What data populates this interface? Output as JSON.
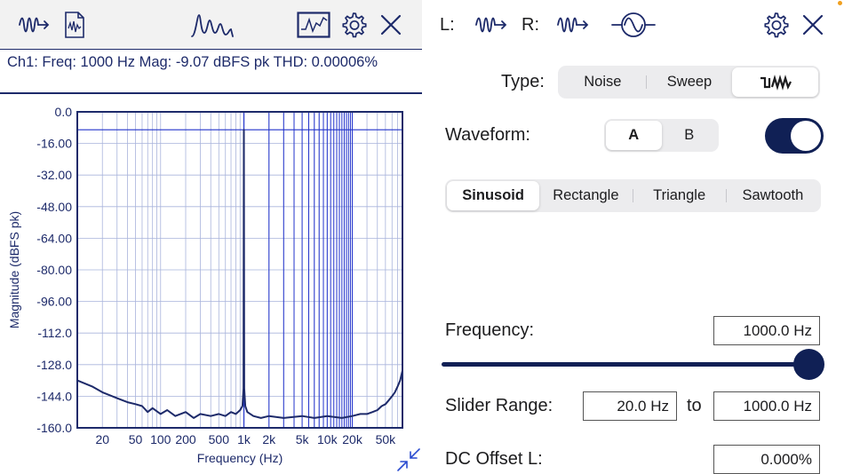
{
  "left_panel": {
    "info_line": "Ch1:  Freq: 1000 Hz   Mag: -9.07 dBFS pk    THD: 0.00006%",
    "toolbar": {
      "icons": [
        "generator-icon",
        "export-file-icon",
        "spectrum-peaks-icon",
        "trace-view-icon",
        "gear-icon",
        "close-icon"
      ]
    }
  },
  "chart_data": {
    "type": "line",
    "title": "",
    "xlabel": "Frequency (Hz)",
    "ylabel": "Magnitude (dBFS pk)",
    "x_scale": "log",
    "xlim": [
      10,
      80000
    ],
    "ylim": [
      -160,
      0
    ],
    "x_ticks": [
      {
        "value": 20,
        "label": "20"
      },
      {
        "value": 50,
        "label": "50"
      },
      {
        "value": 100,
        "label": "100"
      },
      {
        "value": 200,
        "label": "200"
      },
      {
        "value": 500,
        "label": "500"
      },
      {
        "value": 1000,
        "label": "1k"
      },
      {
        "value": 2000,
        "label": "2k"
      },
      {
        "value": 5000,
        "label": "5k"
      },
      {
        "value": 10000,
        "label": "10k"
      },
      {
        "value": 20000,
        "label": "20k"
      },
      {
        "value": 50000,
        "label": "50k"
      }
    ],
    "y_ticks": [
      "0.0",
      "-16.00",
      "-32.00",
      "-48.00",
      "-64.00",
      "-80.00",
      "-96.00",
      "-112.0",
      "-128.0",
      "-144.0",
      "-160.0"
    ],
    "y_tick_values": [
      0,
      -16,
      -32,
      -48,
      -64,
      -80,
      -96,
      -112,
      -128,
      -144,
      -160
    ],
    "grid": true,
    "cursor": {
      "freq": 1000,
      "mag": -9.07
    },
    "harmonic_markers_hz": [
      2000,
      3000,
      4000,
      5000,
      6000,
      7000,
      8000,
      9000,
      10000,
      11000,
      12000,
      13000,
      14000,
      15000,
      16000,
      17000,
      18000,
      19000,
      20000
    ],
    "series": [
      {
        "color": "#1d2a6a",
        "x": [
          10,
          15,
          20,
          30,
          40,
          50,
          60,
          70,
          80,
          100,
          120,
          150,
          200,
          250,
          300,
          400,
          500,
          600,
          700,
          800,
          900,
          960,
          990,
          1000,
          1010,
          1040,
          1100,
          1300,
          1600,
          2000,
          3000,
          5000,
          7000,
          10000,
          15000,
          20000,
          25000,
          30000,
          35000,
          40000,
          45000,
          50000,
          55000,
          60000,
          65000,
          70000,
          75000,
          80000
        ],
        "y": [
          -136,
          -139,
          -142,
          -145,
          -147,
          -148,
          -149,
          -152,
          -150,
          -153,
          -151,
          -154,
          -152,
          -155,
          -153,
          -154,
          -153,
          -154,
          -152,
          -153,
          -151,
          -149,
          -140,
          -9.07,
          -140,
          -149,
          -152,
          -154,
          -155,
          -154,
          -155,
          -154,
          -155,
          -154,
          -155,
          -154,
          -153,
          -153,
          -152,
          -151,
          -149,
          -148,
          -146,
          -144,
          -142,
          -139,
          -136,
          -131
        ]
      }
    ]
  },
  "right_panel": {
    "header": {
      "l_label": "L:",
      "r_label": "R:",
      "icons": [
        "generator-l-icon",
        "generator-r-icon",
        "sine-source-icon",
        "gear-icon",
        "close-icon"
      ]
    },
    "type": {
      "label": "Type:",
      "options": [
        "Noise",
        "Sweep",
        "multitone-icon"
      ],
      "selected": 2
    },
    "waveform": {
      "label": "Waveform:",
      "options": [
        "A",
        "B"
      ],
      "selected": 0,
      "toggle_on": true
    },
    "shape": {
      "options": [
        "Sinusoid",
        "Rectangle",
        "Triangle",
        "Sawtooth"
      ],
      "selected": 0
    },
    "frequency": {
      "label": "Frequency:",
      "value": "1000.0 Hz",
      "slider_fraction": 1.0
    },
    "slider_range": {
      "label": "Slider Range:",
      "min": "20.0 Hz",
      "to_label": "to",
      "max": "1000.0 Hz"
    },
    "dc_offset": {
      "label": "DC Offset L:",
      "value": "0.000%"
    }
  }
}
